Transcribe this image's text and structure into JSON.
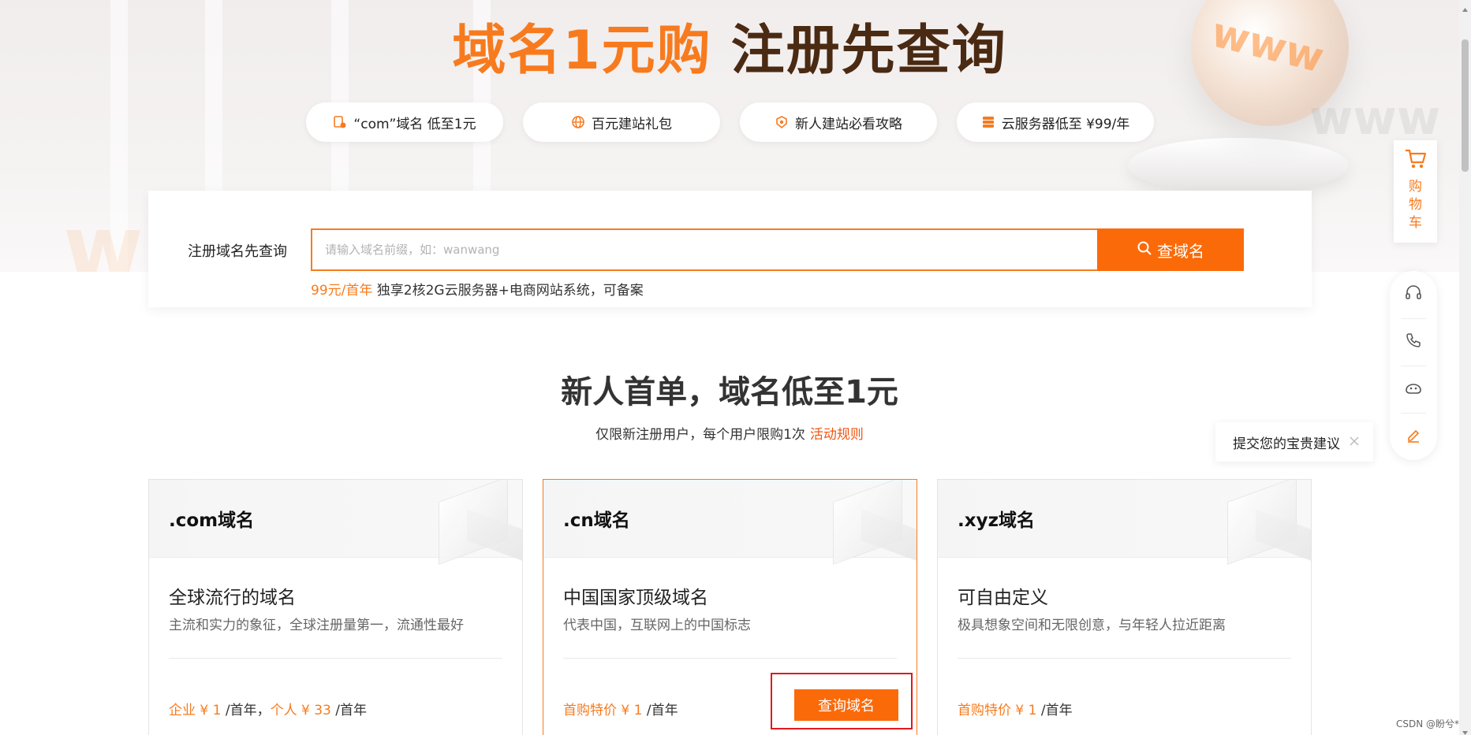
{
  "hero": {
    "headline_orange": "域名1元购",
    "headline_dark": "注册先查询",
    "decor_text": "www",
    "pills": [
      {
        "icon": "domain-tag-icon",
        "label": "“com”域名 低至1元"
      },
      {
        "icon": "globe-icon",
        "label": "百元建站礼包"
      },
      {
        "icon": "shield-guide-icon",
        "label": "新人建站必看攻略"
      },
      {
        "icon": "server-icon",
        "label": "云服务器低至 ¥99/年"
      }
    ]
  },
  "search": {
    "label": "注册域名先查询",
    "placeholder": "请输入域名前缀，如：wanwang",
    "button_label": "查域名",
    "promo_price": "99元/首年",
    "promo_text": " 独享2核2G云服务器+电商网站系统，可备案"
  },
  "section": {
    "title": "新人首单，域名低至1元",
    "subtitle": "仅限新注册用户，每个用户限购1次",
    "rules_link": "活动规则"
  },
  "cards": [
    {
      "name": ".com域名",
      "title": "全球流行的域名",
      "desc": "主流和实力的象征，全球注册量第一，流通性最好",
      "price_a": "企业 ¥ 1",
      "price_a_unit": " /首年，",
      "price_b": "个人 ¥ 33",
      "price_b_unit": " /首年"
    },
    {
      "name": ".cn域名",
      "title": "中国国家顶级域名",
      "desc": "代表中国，互联网上的中国标志",
      "price_a": "首购特价 ¥ 1",
      "price_a_unit": " /首年",
      "button_label": "查询域名"
    },
    {
      "name": ".xyz域名",
      "title": "可自由定义",
      "desc": "极具想象空间和无限创意，与年轻人拉近距离",
      "price_a": "首购特价 ¥ 1",
      "price_a_unit": " /首年"
    }
  ],
  "sidebar": {
    "cart_label": "购物车",
    "tools": [
      "headset-icon",
      "phone-icon",
      "chat-bot-icon",
      "edit-icon"
    ],
    "suggest_text": "提交您的宝贵建议"
  },
  "watermark": "CSDN @盼兮*",
  "colors": {
    "accent": "#fb6a09",
    "accent_text": "#f77b1e",
    "outline": "#e0191f"
  }
}
